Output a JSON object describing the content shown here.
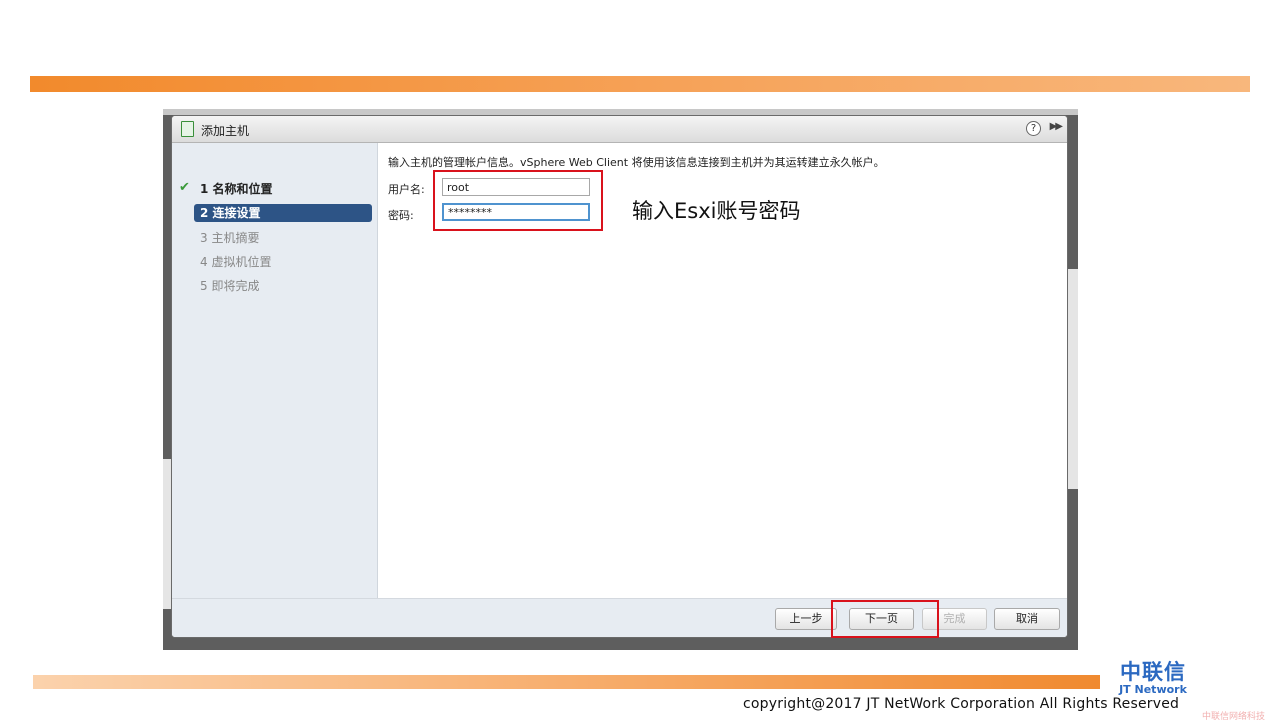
{
  "dialog": {
    "title": "添加主机",
    "help_icon": "?",
    "expand_icon": "▶▶"
  },
  "nav": {
    "steps": [
      {
        "label": "1  名称和位置",
        "state": "done"
      },
      {
        "label": "2  连接设置",
        "state": "active"
      },
      {
        "label": "3  主机摘要",
        "state": "pending"
      },
      {
        "label": "4  虚拟机位置",
        "state": "pending"
      },
      {
        "label": "5  即将完成",
        "state": "pending"
      }
    ],
    "check_icon": "✔"
  },
  "form": {
    "instruction": "输入主机的管理帐户信息。vSphere Web Client 将使用该信息连接到主机并为其运转建立永久帐户。",
    "username_label": "用户名:",
    "username_value": "root",
    "password_label": "密码:",
    "password_value": "********"
  },
  "buttons": {
    "back": "上一步",
    "next": "下一页",
    "finish": "完成",
    "cancel": "取消"
  },
  "annotation": "输入Esxi账号密码",
  "brand": {
    "logo_cn": "中联信",
    "logo_en": "JT Network",
    "copyright": "copyright@2017  JT NetWork Corporation All Rights Reserved",
    "watermark": "中联信网络科技"
  },
  "colors": {
    "accent_orange": "#f28a2c",
    "nav_active": "#2d5486",
    "highlight_red": "#d9121c",
    "brand_blue": "#2b69c1"
  }
}
